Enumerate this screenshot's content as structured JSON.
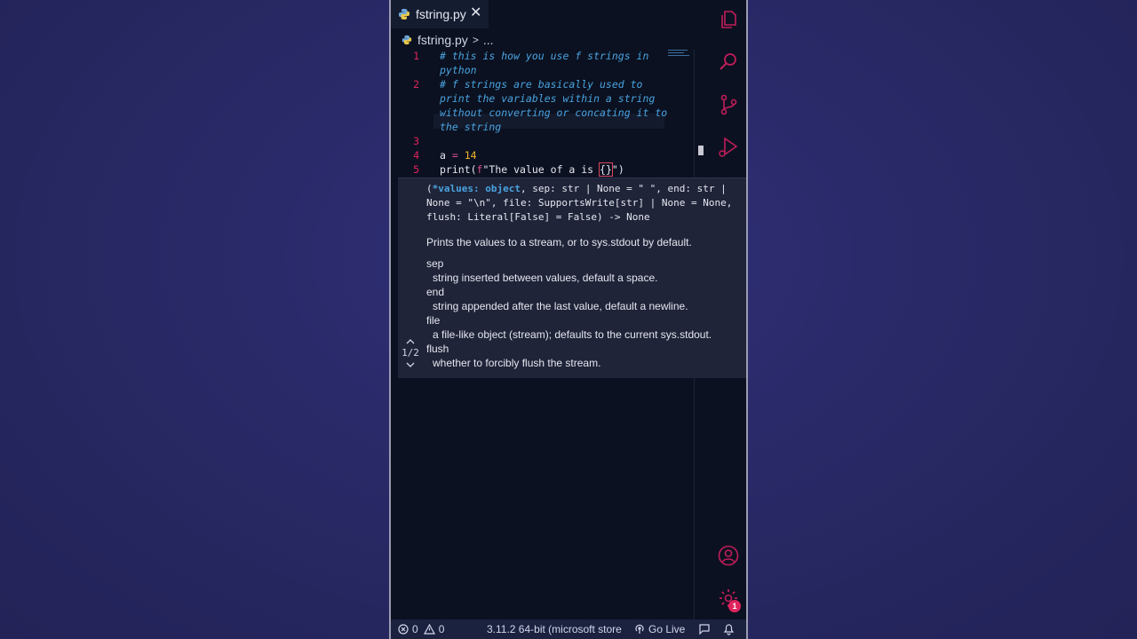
{
  "tab": {
    "title": "fstring.py",
    "close": "✕"
  },
  "toolbar": {
    "more": "···"
  },
  "breadcrumb": {
    "file": "fstring.py",
    "sep": ">",
    "more": "..."
  },
  "code": {
    "line_numbers": [
      "1",
      "2",
      "3",
      "4",
      "5"
    ],
    "l1a": "# this is how you use f strings in",
    "l1b": "python",
    "l2a": "# f strings are basically used to",
    "l2b": "print the variables within a string",
    "l2c": "without converting or concating it to",
    "l2d": "the string",
    "l4_var": "a",
    "l4_op": " = ",
    "l4_num": "14",
    "l5_fn": "print(",
    "l5_pre": "f",
    "l5_str": "\"The value of a is ",
    "l5_brace": "{}",
    "l5_end": "\")"
  },
  "hover": {
    "sig_open": "(",
    "sig_param": "*values: object",
    "sig_rest1": ", sep: str | None = \" \", end: str |",
    "sig_rest2": "None = \"\\n\", file: SupportsWrite[str] | None = None,",
    "sig_rest3": "flush: Literal[False] = False) -> None",
    "summary": "Prints the values to a stream, or to sys.stdout by default.",
    "params": [
      {
        "name": "sep",
        "desc": "string inserted between values, default a space."
      },
      {
        "name": "end",
        "desc": "string appended after the last value, default a newline."
      },
      {
        "name": "file",
        "desc": "a file-like object (stream); defaults to the current sys.stdout."
      },
      {
        "name": "flush",
        "desc": "whether to forcibly flush the stream."
      }
    ],
    "pager": "1/2"
  },
  "status": {
    "errors": "0",
    "warnings": "0",
    "interpreter": "3.11.2 64-bit (microsoft store",
    "golive": "Go Live"
  },
  "badges": {
    "settings": "1"
  },
  "colors": {
    "accent": "#e0245e",
    "comment": "#4aa3e0",
    "number": "#f0b429",
    "background": "#0b1120"
  }
}
